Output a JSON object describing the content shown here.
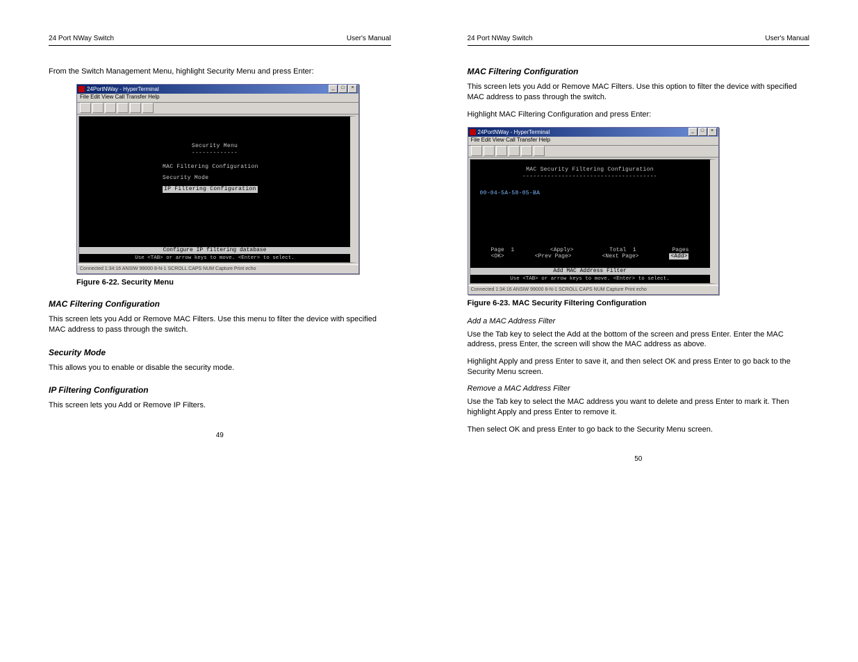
{
  "left": {
    "header_left": "24 Port NWay Switch",
    "header_right": "User's Manual",
    "body1": "From the Switch Management Menu, highlight Security Menu and press Enter:",
    "fig_caption": "Figure 6-22. Security Menu",
    "sub_mac_title": "MAC Filtering Configuration",
    "sub_mac_body": "This screen lets you Add or Remove MAC Filters. Use this menu to filter the device with specified MAC address to pass through the switch.",
    "sub_mode_title": "Security Mode",
    "sub_mode_body": "This allows you to enable or disable the security mode.",
    "sub_ip_title": "IP Filtering Configuration",
    "sub_ip_body": "This screen lets you Add or Remove IP Filters.",
    "page_num": "49",
    "win": {
      "title": "24PortNWay - HyperTerminal",
      "menu": "File  Edit  View  Call  Transfer  Help",
      "screen_title": "Security Menu",
      "item1": "MAC Filtering Configuration",
      "item2": "Security Mode",
      "item3_sel": "IP Filtering Configuration",
      "footer1": "Configure IP filtering database",
      "footer2": "Use <TAB> or arrow keys to move. <Enter> to select.",
      "status": "Connected 1:34:16    ANSIW    99000 8-N-1    SCROLL   CAPS   NUM   Capture   Print echo"
    }
  },
  "right": {
    "header_left": "24 Port NWay Switch",
    "header_right": "User's Manual",
    "sub_title": "MAC Filtering Configuration",
    "body1": "This screen lets you Add or Remove MAC Filters. Use this option to filter the device with specified MAC address to pass through the switch.",
    "body2": "Highlight MAC Filtering Configuration and press Enter:",
    "fig_caption": "Figure 6-23.  MAC Security Filtering Configuration",
    "add_title": "Add a MAC Address Filter",
    "add_body1": "Use the Tab key to select the Add at the bottom of the screen and press Enter. Enter the MAC address, press Enter, the screen will show the MAC address as above.",
    "add_body2": "Highlight Apply and press Enter to save it, and then select OK and press Enter to go back to the Security Menu screen.",
    "rem_title": "Remove a MAC Address Filter",
    "rem_body1": "Use the Tab key to select the MAC address you want to delete and press Enter to mark it. Then highlight Apply and press Enter to remove it.",
    "rem_body2": "Then select OK and press Enter to go back to the Security Menu screen.",
    "page_num": "50",
    "win": {
      "title": "24PortNWay - HyperTerminal",
      "menu": "File  Edit  View  Call  Transfer  Help",
      "screen_title": "MAC Security Filtering Configuration",
      "mac": "00-04-5A-58-05-BA",
      "page_lbl": "Page",
      "page_val": "1",
      "apply": "<Apply>",
      "total_lbl": "Total",
      "total_val": "1",
      "pages_lbl": "Pages",
      "ok": "<OK>",
      "prev": "<Prev Page>",
      "next": "<Next Page>",
      "add_sel": "<Add>",
      "footer1": "Add MAC Address Filter",
      "footer2": "Use <TAB> or arrow keys to move. <Enter> to select.",
      "status": "Connected 1:34:16    ANSIW    99000 8-N-1    SCROLL   CAPS   NUM   Capture   Print echo"
    }
  }
}
